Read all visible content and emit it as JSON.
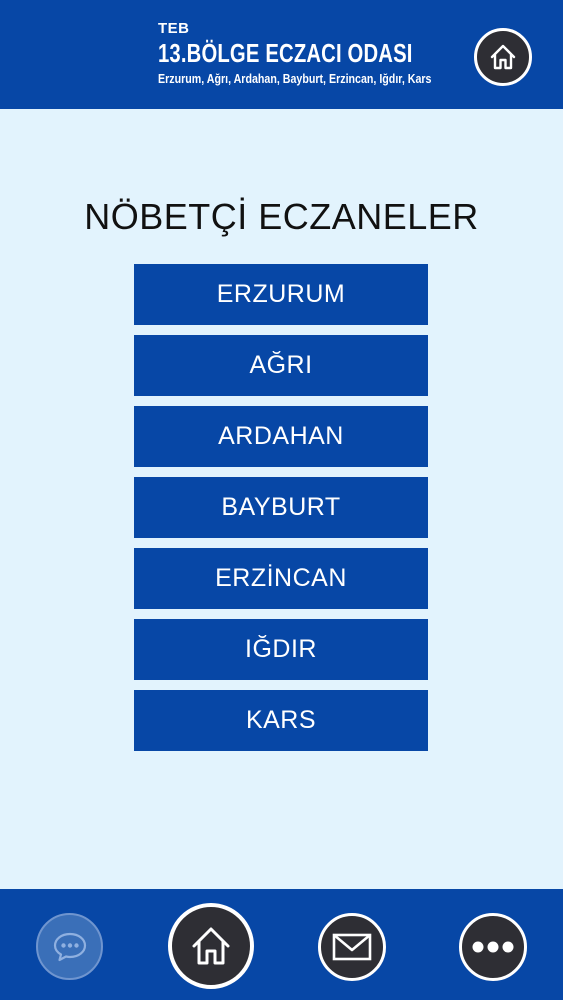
{
  "header": {
    "org_small": "TEB",
    "org_title": "13.BÖLGE ECZACI ODASI",
    "org_subtitle": "Erzurum, Ağrı, Ardahan, Bayburt, Erzincan, Iğdır, Kars",
    "home_icon": "home-icon"
  },
  "main": {
    "title": "NÖBETÇİ ECZANELER",
    "cities": [
      {
        "label": "ERZURUM"
      },
      {
        "label": "AĞRI"
      },
      {
        "label": "ARDAHAN"
      },
      {
        "label": "BAYBURT"
      },
      {
        "label": "ERZİNCAN"
      },
      {
        "label": "IĞDIR"
      },
      {
        "label": "KARS"
      }
    ]
  },
  "bottom_nav": {
    "items": [
      {
        "icon": "chat-icon"
      },
      {
        "icon": "home-icon"
      },
      {
        "icon": "mail-icon"
      },
      {
        "icon": "more-icon"
      }
    ]
  },
  "colors": {
    "brand_blue": "#0747a6",
    "background": "#e2f3fd",
    "button_dark": "#2e2e34"
  }
}
